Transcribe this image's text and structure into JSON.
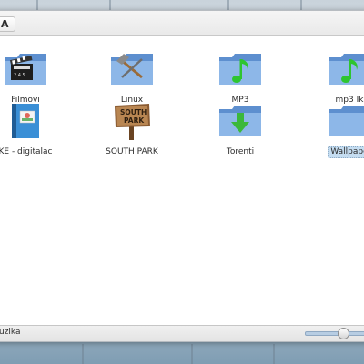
{
  "window": {
    "path_crumb": "A"
  },
  "files": [
    {
      "label": "Filmovi",
      "icon": "folder-film-icon",
      "selected": false
    },
    {
      "label": "Linux",
      "icon": "folder-tools-icon",
      "selected": false
    },
    {
      "label": "MP3",
      "icon": "folder-music-icon",
      "selected": false
    },
    {
      "label": "mp3 Ik",
      "icon": "folder-music-icon",
      "selected": false
    },
    {
      "label": "KE - digitalac",
      "icon": "notebook-image-icon",
      "selected": false
    },
    {
      "label": "SOUTH PARK",
      "icon": "south-park-sign-icon",
      "selected": false
    },
    {
      "label": "Torenti",
      "icon": "folder-download-icon",
      "selected": false
    },
    {
      "label": "Wallpape",
      "icon": "folder-icon",
      "selected": true
    }
  ],
  "south_park_sign": {
    "line1": "SOUTH",
    "line2": "PARK"
  },
  "status_bar": {
    "text": "uzika"
  },
  "zoom": {
    "level": 0.5
  },
  "colors": {
    "folder_blue": "#7ca9e0",
    "selection": "#c5ddf1",
    "music_note": "#2ec530",
    "download_arrow": "#3bb83b"
  }
}
